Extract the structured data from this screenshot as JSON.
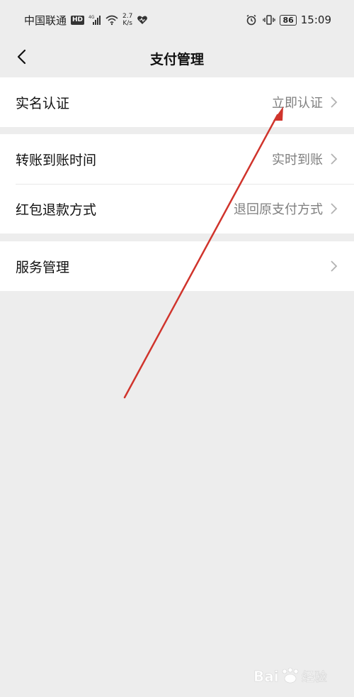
{
  "status_bar": {
    "carrier": "中国联通",
    "hd": "HD",
    "network": "4G",
    "speed_value": "2.7",
    "speed_unit": "K/s",
    "battery": "86",
    "time": "15:09"
  },
  "nav": {
    "title": "支付管理"
  },
  "groups": [
    {
      "rows": [
        {
          "label": "实名认证",
          "value": "立即认证"
        }
      ]
    },
    {
      "rows": [
        {
          "label": "转账到账时间",
          "value": "实时到账"
        },
        {
          "label": "红包退款方式",
          "value": "退回原支付方式"
        }
      ]
    },
    {
      "rows": [
        {
          "label": "服务管理",
          "value": ""
        }
      ]
    }
  ],
  "colors": {
    "background": "#ededed",
    "annotation_arrow": "#d0342c"
  }
}
